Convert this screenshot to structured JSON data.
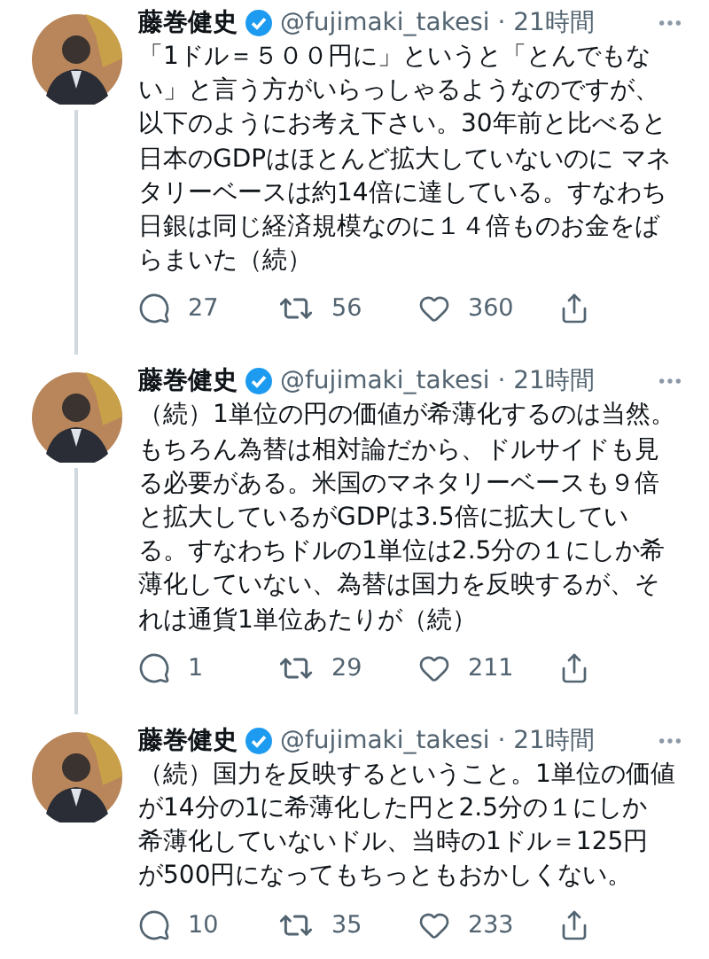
{
  "tweets": [
    {
      "name": "藤巻健史",
      "verified": true,
      "meta": "@fujimaki_takesi · 21時間",
      "lines": [
        "「1ドル＝５００円に」というと「とんでもな",
        "い」と言う方がいらっしゃるようなのですが、",
        "以下のようにお考え下さい。30年前と比べると",
        "日本のGDPはほとんど拡大していないのに マネ",
        "タリーベースは約14倍に達している。すなわち",
        "日銀は同じ経済規模なのに１４倍ものお金をば",
        "らまいた（続）"
      ],
      "replies": "27",
      "retweets": "56",
      "likes": "360",
      "connected": true
    },
    {
      "name": "藤巻健史",
      "verified": true,
      "meta": "@fujimaki_takesi · 21時間",
      "lines": [
        "（続）1単位の円の価値が希薄化するのは当然。",
        "もちろん為替は相対論だから、ドルサイドも見",
        "る必要がある。米国のマネタリーベースも９倍",
        "と拡大しているがGDPは3.5倍に拡大してい",
        "る。すなわちドルの1単位は2.5分の１にしか希",
        "薄化していない、為替は国力を反映するが、そ",
        "れは通貨1単位あたりが（続）"
      ],
      "replies": "1",
      "retweets": "29",
      "likes": "211",
      "connected": true
    },
    {
      "name": "藤巻健史",
      "verified": true,
      "meta": "@fujimaki_takesi · 21時間",
      "lines": [
        "（続）国力を反映するということ。1単位の価値",
        "が14分の1に希薄化した円と2.5分の１にしか",
        "希薄化していないドル、当時の1ドル＝125円",
        "が500円になってもちっともおかしくない。"
      ],
      "replies": "10",
      "retweets": "35",
      "likes": "233",
      "connected": false
    }
  ]
}
